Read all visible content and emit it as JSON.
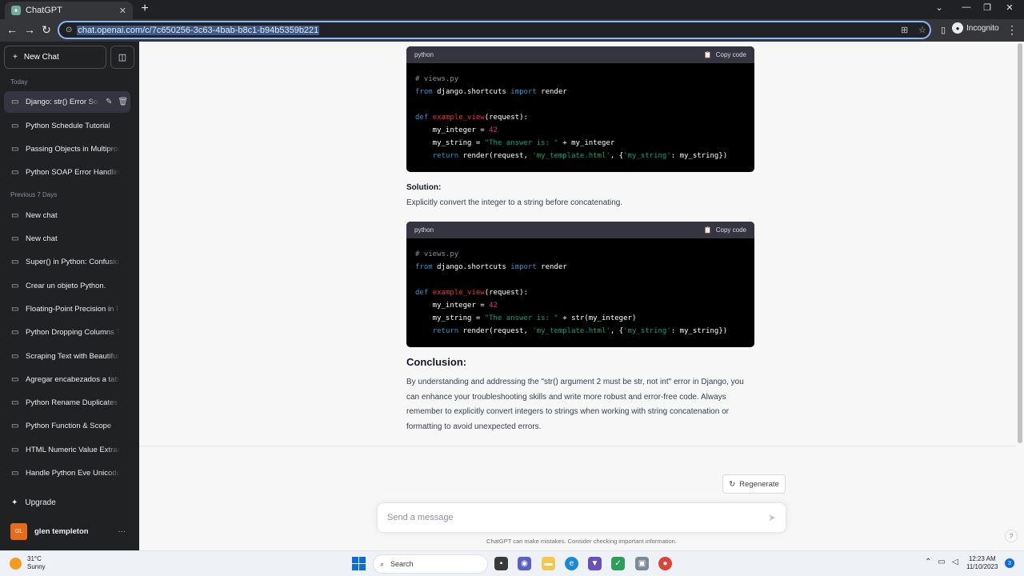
{
  "browser": {
    "tab_title": "ChatGPT",
    "tab_close": "✕",
    "new_tab": "+",
    "url": "chat.openai.com/c/7c650256-3c63-4bab-b8c1-b94b5359b221",
    "profile_label": "Incognito"
  },
  "sidebar": {
    "new_chat_label": "New Chat",
    "sections": {
      "today": "Today",
      "previous": "Previous 7 Days"
    },
    "today_items": [
      {
        "label": "Django: str() Error Sol"
      },
      {
        "label": "Python Schedule Tutorial"
      },
      {
        "label": "Passing Objects in Multiprocessing"
      },
      {
        "label": "Python SOAP Error Handling"
      }
    ],
    "previous_items": [
      {
        "label": "New chat"
      },
      {
        "label": "New chat"
      },
      {
        "label": "Super() in Python: Confusion"
      },
      {
        "label": "Crear un objeto Python."
      },
      {
        "label": "Floating-Point Precision in Python"
      },
      {
        "label": "Python Dropping Columns Tutorial"
      },
      {
        "label": "Scraping Text with BeautifulSoup"
      },
      {
        "label": "Agregar encabezados a tablas"
      },
      {
        "label": "Python Rename Duplicates Tutorial"
      },
      {
        "label": "Python Function & Scope"
      },
      {
        "label": "HTML Numeric Value Extraction"
      },
      {
        "label": "Handle Python Eve Unicode"
      }
    ],
    "upgrade_label": "Upgrade",
    "user_initials": "GL",
    "user_name": "glen templeton",
    "more": "···"
  },
  "chat": {
    "code1": {
      "lang": "python",
      "copy_label": "Copy code"
    },
    "solution_heading": "Solution:",
    "solution_text": "Explicitly convert the integer to a string before concatenating.",
    "code2": {
      "lang": "python",
      "copy_label": "Copy code"
    },
    "conclusion_heading": "Conclusion:",
    "conclusion_text": "By understanding and addressing the \"str() argument 2 must be str, not int\" error in Django, you can enhance your troubleshooting skills and write more robust and error-free code. Always remember to explicitly convert integers to strings when working with string concatenation or formatting to avoid unexpected errors.",
    "regenerate_label": "Regenerate",
    "input_placeholder": "Send a message",
    "disclaimer": "ChatGPT can make mistakes. Consider checking important information.",
    "help": "?"
  },
  "taskbar": {
    "temperature": "31°C",
    "condition": "Sunny",
    "search_label": "Search",
    "time": "12:23 AM",
    "date": "11/10/2023",
    "notification_count": "3"
  },
  "icons": [
    "chat-bubble-icon",
    "pencil-icon",
    "trash-icon",
    "plus-icon",
    "sparkle-icon",
    "clipboard-icon",
    "refresh-icon",
    "send-icon"
  ]
}
